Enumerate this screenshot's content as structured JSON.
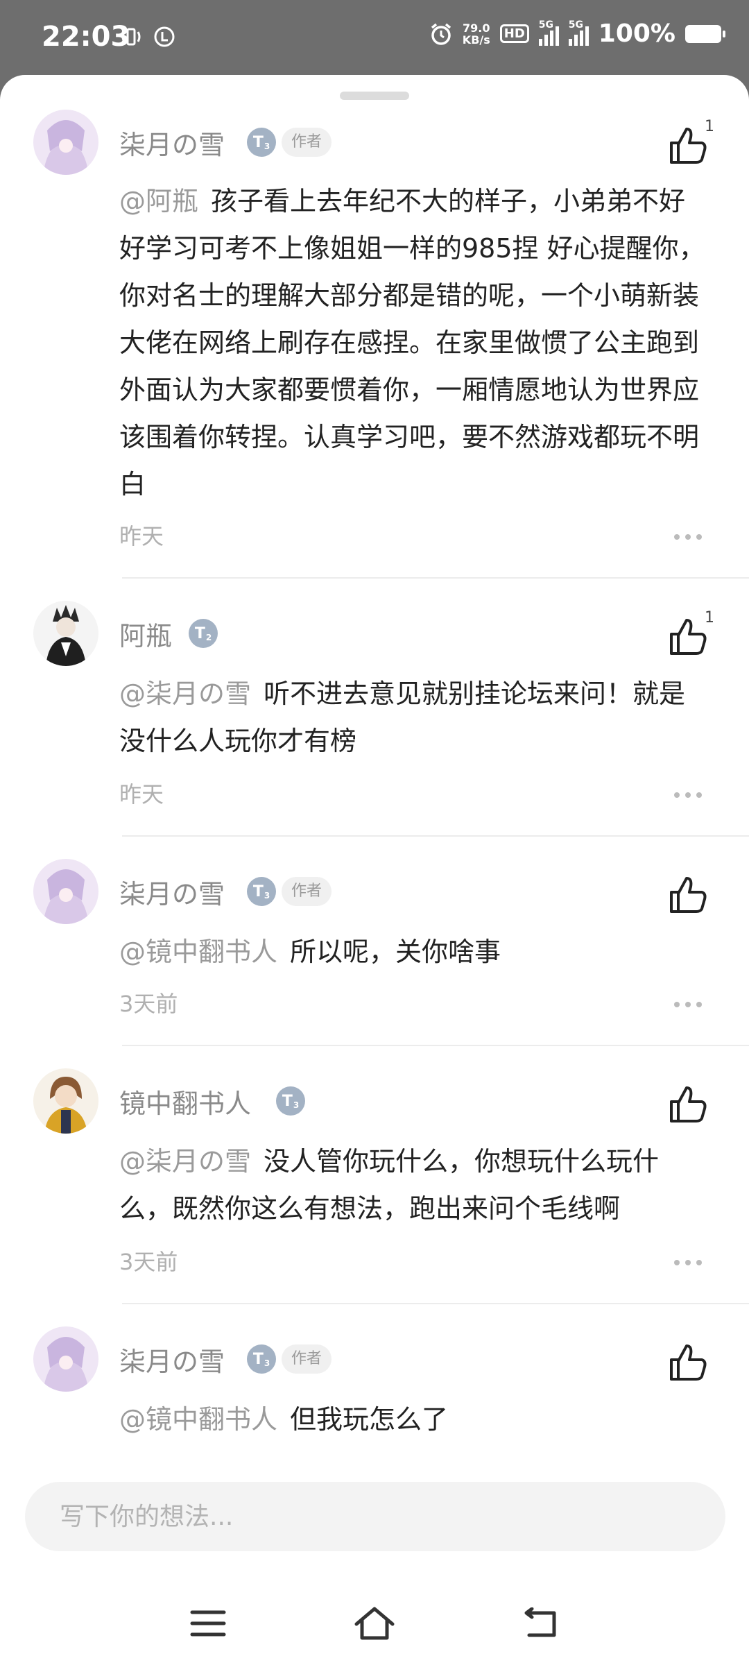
{
  "status_bar": {
    "time": "22:03",
    "net_speed_value": "79.0",
    "net_speed_unit": "KB/s",
    "hd_label": "HD",
    "signal1_label": "5G",
    "signal2_label": "5G",
    "battery_text": "100%"
  },
  "comments": [
    {
      "author": "柒月の雪",
      "level": "T",
      "level_num": "3",
      "tag": "作者",
      "mention": "@阿瓶",
      "text": "孩子看上去年纪不大的样子，小弟弟不好好学习可考不上像姐姐一样的985捏 好心提醒你，你对名士的理解大部分都是错的呢，一个小萌新装大佬在网络上刷存在感捏。在家里做惯了公主跑到外面认为大家都要惯着你，一厢情愿地认为世界应该围着你转捏。认真学习吧，要不然游戏都玩不明白",
      "time": "昨天",
      "likes": "1"
    },
    {
      "author": "阿瓶",
      "level": "T",
      "level_num": "2",
      "tag": "",
      "mention": "@柒月の雪",
      "text": "听不进去意见就别挂论坛来问！就是没什么人玩你才有榜",
      "time": "昨天",
      "likes": "1"
    },
    {
      "author": "柒月の雪",
      "level": "T",
      "level_num": "3",
      "tag": "作者",
      "mention": "@镜中翻书人",
      "text": "所以呢，关你啥事",
      "time": "3天前",
      "likes": ""
    },
    {
      "author": "镜中翻书人",
      "level": "T",
      "level_num": "3",
      "tag": "",
      "mention": "@柒月の雪",
      "text": "没人管你玩什么，你想玩什么玩什么，既然你这么有想法，跑出来问个毛线啊",
      "time": "3天前",
      "likes": ""
    },
    {
      "author": "柒月の雪",
      "level": "T",
      "level_num": "3",
      "tag": "作者",
      "mention": "@镜中翻书人",
      "text": "但我玩怎么了",
      "time": "",
      "likes": ""
    }
  ],
  "input": {
    "placeholder": "写下你的想法..."
  },
  "nav": {
    "menu_icon": "menu-icon",
    "home_icon": "home-icon",
    "back_icon": "back-icon"
  },
  "colors": {
    "accent_gray": "#8a8a8a",
    "badge": "#a3b2c4",
    "status_bar_bg": "#6e6e6e"
  }
}
